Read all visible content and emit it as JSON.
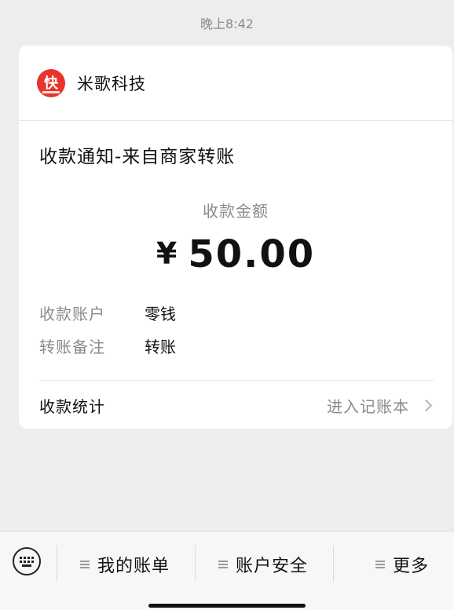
{
  "timestamp": "晚上8:42",
  "card": {
    "brand_name": "米歌科技",
    "logo_text": "快",
    "title": "收款通知-来自商家转账",
    "amount_label": "收款金额",
    "currency": "¥",
    "amount": "50.00",
    "details": [
      {
        "key": "收款账户",
        "value": "零钱"
      },
      {
        "key": "转账备注",
        "value": "转账"
      }
    ],
    "stats_label": "收款统计",
    "stats_link": "进入记账本"
  },
  "bottom_menu": {
    "items": [
      {
        "label": "我的账单"
      },
      {
        "label": "账户安全"
      },
      {
        "label": "更多"
      }
    ]
  },
  "colors": {
    "background": "#ededed",
    "card": "#ffffff",
    "logo_red": "#e8352b",
    "muted_text": "#8a8a8a"
  }
}
